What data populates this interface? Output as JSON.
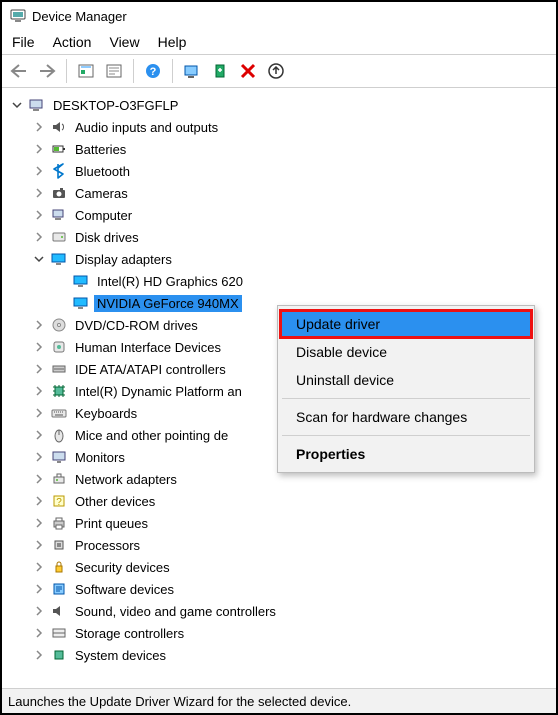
{
  "window": {
    "title": "Device Manager"
  },
  "menubar": [
    "File",
    "Action",
    "View",
    "Help"
  ],
  "toolbar_icons": [
    "back",
    "forward",
    "|",
    "show-hidden",
    "properties",
    "|",
    "help",
    "|",
    "monitor",
    "scan",
    "delete",
    "update"
  ],
  "tree": {
    "root": {
      "label": "DESKTOP-O3FGFLP",
      "icon": "computer-icon",
      "expanded": true
    },
    "categories": [
      {
        "label": "Audio inputs and outputs",
        "icon": "speaker-icon",
        "expanded": false
      },
      {
        "label": "Batteries",
        "icon": "battery-icon",
        "expanded": false
      },
      {
        "label": "Bluetooth",
        "icon": "bluetooth-icon",
        "expanded": false
      },
      {
        "label": "Cameras",
        "icon": "camera-icon",
        "expanded": false
      },
      {
        "label": "Computer",
        "icon": "pc-icon",
        "expanded": false
      },
      {
        "label": "Disk drives",
        "icon": "disk-icon",
        "expanded": false
      },
      {
        "label": "Display adapters",
        "icon": "display-icon",
        "expanded": true,
        "children": [
          {
            "label": "Intel(R) HD Graphics 620",
            "icon": "display-icon",
            "selected": false
          },
          {
            "label": "NVIDIA GeForce 940MX",
            "icon": "display-icon",
            "selected": true
          }
        ]
      },
      {
        "label": "DVD/CD-ROM drives",
        "icon": "optical-icon",
        "expanded": false
      },
      {
        "label": "Human Interface Devices",
        "icon": "hid-icon",
        "expanded": false
      },
      {
        "label": "IDE ATA/ATAPI controllers",
        "icon": "ide-icon",
        "expanded": false
      },
      {
        "label": "Intel(R) Dynamic Platform and Thermal Framework",
        "icon": "chip-icon",
        "expanded": false,
        "truncated": "Intel(R) Dynamic Platform an"
      },
      {
        "label": "Keyboards",
        "icon": "keyboard-icon",
        "expanded": false
      },
      {
        "label": "Mice and other pointing devices",
        "icon": "mouse-icon",
        "expanded": false,
        "truncated": "Mice and other pointing de"
      },
      {
        "label": "Monitors",
        "icon": "monitor-icon",
        "expanded": false
      },
      {
        "label": "Network adapters",
        "icon": "network-icon",
        "expanded": false
      },
      {
        "label": "Other devices",
        "icon": "other-icon",
        "expanded": false
      },
      {
        "label": "Print queues",
        "icon": "printer-icon",
        "expanded": false
      },
      {
        "label": "Processors",
        "icon": "cpu-icon",
        "expanded": false
      },
      {
        "label": "Security devices",
        "icon": "security-icon",
        "expanded": false
      },
      {
        "label": "Software devices",
        "icon": "software-icon",
        "expanded": false
      },
      {
        "label": "Sound, video and game controllers",
        "icon": "sound-icon",
        "expanded": false
      },
      {
        "label": "Storage controllers",
        "icon": "storage-icon",
        "expanded": false
      },
      {
        "label": "System devices",
        "icon": "system-icon",
        "expanded": false,
        "truncated": "System devices"
      }
    ]
  },
  "context_menu": {
    "items": [
      {
        "label": "Update driver",
        "highlight": true
      },
      {
        "label": "Disable device"
      },
      {
        "label": "Uninstall device"
      },
      {
        "separator": true
      },
      {
        "label": "Scan for hardware changes"
      },
      {
        "separator": true
      },
      {
        "label": "Properties",
        "bold": true
      }
    ]
  },
  "statusbar": {
    "text": "Launches the Update Driver Wizard for the selected device."
  }
}
